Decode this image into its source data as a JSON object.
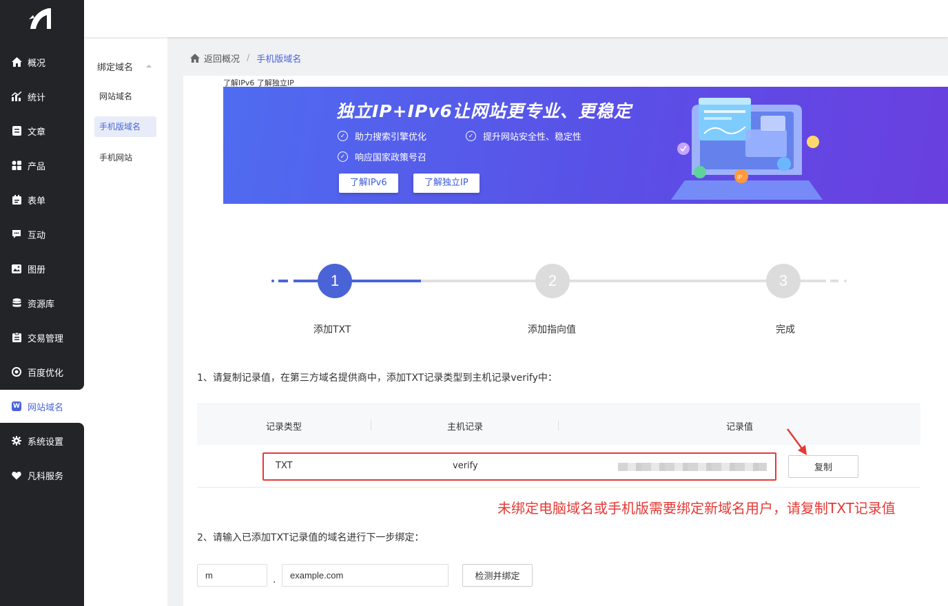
{
  "sidebar": {
    "items": [
      {
        "label": "概况",
        "icon": "home-icon"
      },
      {
        "label": "统计",
        "icon": "stats-icon"
      },
      {
        "label": "文章",
        "icon": "article-icon"
      },
      {
        "label": "产品",
        "icon": "grid-icon"
      },
      {
        "label": "表单",
        "icon": "form-icon"
      },
      {
        "label": "互动",
        "icon": "chat-icon"
      },
      {
        "label": "图册",
        "icon": "album-icon"
      },
      {
        "label": "资源库",
        "icon": "database-icon"
      },
      {
        "label": "交易管理",
        "icon": "trade-icon"
      },
      {
        "label": "百度优化",
        "icon": "seo-icon"
      },
      {
        "label": "网站域名",
        "icon": "w-icon",
        "active": true
      },
      {
        "label": "系统设置",
        "icon": "gear-icon"
      },
      {
        "label": "凡科服务",
        "icon": "heart-icon"
      }
    ]
  },
  "submenu": {
    "header": "绑定域名",
    "items": [
      "网站域名",
      "手机版域名",
      "手机网站"
    ]
  },
  "breadcrumb": {
    "back": "返回概况",
    "separator": "/",
    "current": "手机版域名"
  },
  "banner": {
    "tiny_links": "了解IPv6 了解独立IP",
    "title": "独立IP+IPv6让网站更专业、更稳定",
    "features": [
      "助力搜索引擎优化",
      "提升网站安全性、稳定性",
      "响应国家政策号召"
    ],
    "buttons": [
      "了解IPv6",
      "了解独立IP"
    ]
  },
  "steps": [
    {
      "num": "1",
      "label": "添加TXT",
      "active": true
    },
    {
      "num": "2",
      "label": "添加指向值",
      "active": false
    },
    {
      "num": "3",
      "label": "完成",
      "active": false
    }
  ],
  "instructions": {
    "step1": "1、请复制记录值，在第三方域名提供商中，添加TXT记录类型到主机记录verify中：",
    "step2": "2、请输入已添加TXT记录值的域名进行下一步绑定："
  },
  "table": {
    "headers": [
      "记录类型",
      "主机记录",
      "记录值"
    ],
    "row": {
      "type": "TXT",
      "host": "verify"
    },
    "copy_label": "复制"
  },
  "note": "未绑定电脑域名或手机版需要绑定新域名用户，请复制TXT记录值",
  "form": {
    "prefix_value": "m",
    "domain_value": "example.com",
    "dot": ".",
    "submit_label": "检测并绑定"
  },
  "colors": {
    "accent": "#4a64d8",
    "sidebar_bg": "#222428",
    "alert_red": "#e53935"
  }
}
